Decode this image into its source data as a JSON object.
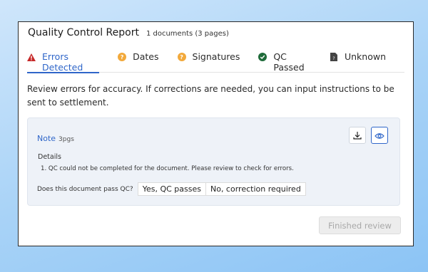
{
  "header": {
    "title": "Quality Control Report",
    "subtitle": "1 documents (3 pages)"
  },
  "tabs": [
    {
      "label": "Errors Detected",
      "icon": "warning-triangle-icon",
      "active": true
    },
    {
      "label": "Dates",
      "icon": "question-circle-icon"
    },
    {
      "label": "Signatures",
      "icon": "question-circle-icon"
    },
    {
      "label": "QC Passed",
      "icon": "check-circle-icon"
    },
    {
      "label": "Unknown",
      "icon": "unknown-document-icon"
    }
  ],
  "description": "Review errors for accuracy. If corrections are needed, you can input instructions to be sent to settlement.",
  "document": {
    "title": "Note",
    "pages": "3pgs",
    "details_label": "Details",
    "details_item": "1. QC could not be completed for the document. Please review to check for errors.",
    "qc_question": "Does this document pass QC?",
    "qc_yes": "Yes, QC passes",
    "qc_no": "No, correction required"
  },
  "finish_button": "Finished review",
  "colors": {
    "accent": "#2f66c9",
    "error": "#c62828",
    "warning": "#f2a93b",
    "success": "#1f6b3a"
  }
}
